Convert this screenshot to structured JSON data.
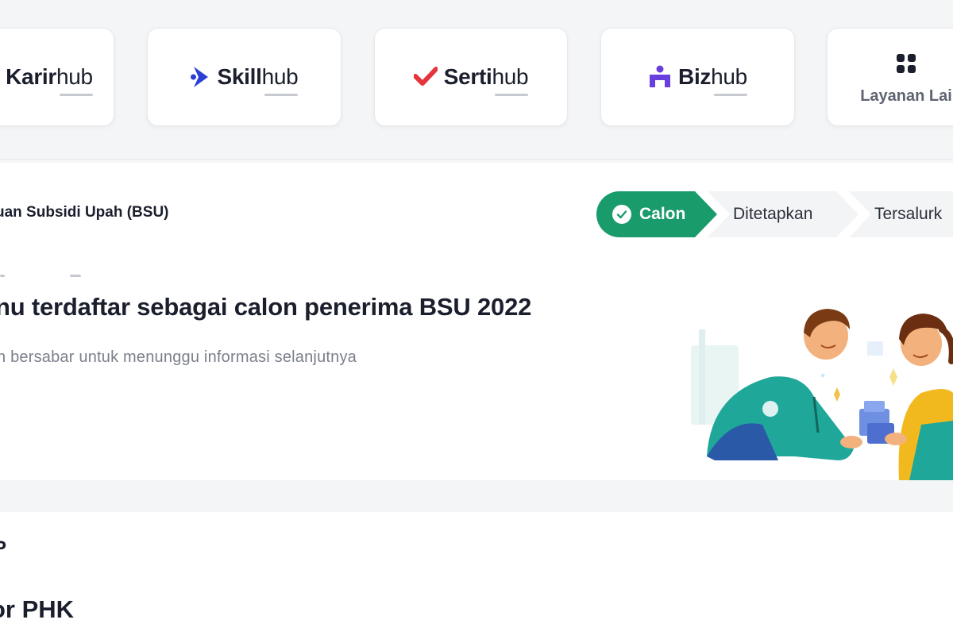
{
  "services": {
    "cards": [
      {
        "bold": "Karir",
        "light": "hub"
      },
      {
        "bold": "Skill",
        "light": "hub"
      },
      {
        "bold": "Serti",
        "light": "hub"
      },
      {
        "bold": "Biz",
        "light": "hub"
      }
    ],
    "more_label": "Layanan Lai",
    "icons": [
      "karirhub-logo-icon",
      "skillhub-logo-icon",
      "sertihub-logo-icon",
      "bizhub-logo-icon",
      "grid-icon"
    ],
    "colors": {
      "skillhub": "#2b3fd6",
      "sertihub": "#e5343d",
      "bizhub": "#6a3fe0"
    }
  },
  "bsu": {
    "title": "uan Subsidi Upah (BSU)",
    "steps": [
      {
        "label": "Calon",
        "active": true
      },
      {
        "label": "Ditetapkan",
        "active": false
      },
      {
        "label": "Tersalurk",
        "active": false
      }
    ],
    "headline": "nu terdaftar sebagai calon penerima BSU 2022",
    "subtext": "n bersabar untuk menunggu informasi selanjutnya",
    "accent": "#1a9b6c"
  },
  "lower": {
    "small": "P",
    "heading": "or PHK"
  }
}
